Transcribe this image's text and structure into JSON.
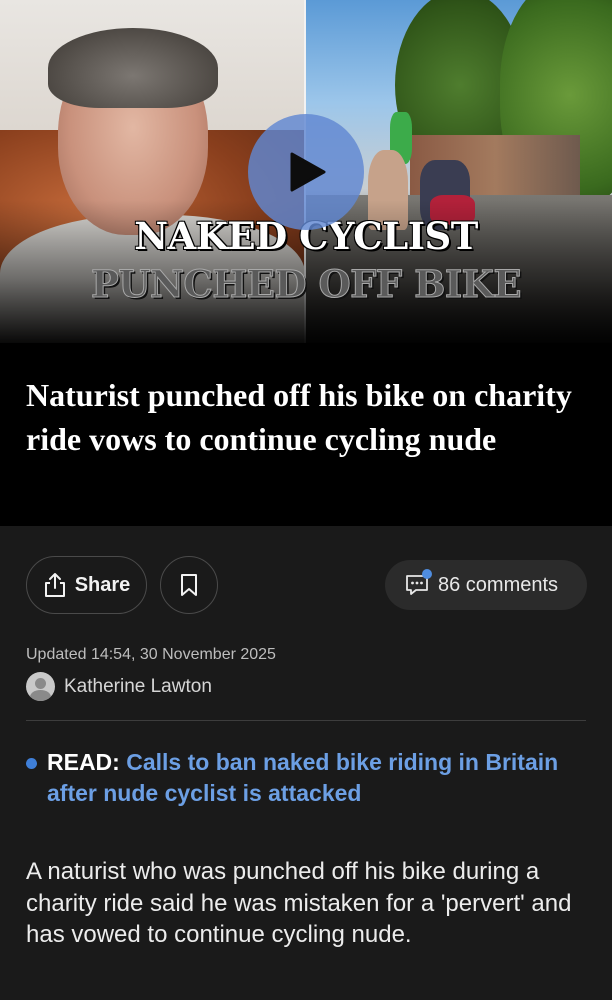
{
  "video": {
    "overlay_line1": "NAKED CYCLIST",
    "overlay_line2": "PUNCHED OFF BIKE"
  },
  "article": {
    "headline": "Naturist punched off his bike on charity ride vows to continue cycling nude",
    "updated": "Updated 14:54, 30 November 2025",
    "author": "Katherine Lawton",
    "read_label": "READ:",
    "read_link": "Calls to ban naked bike riding in Britain after nude cyclist is attacked",
    "body": "A naturist who was punched off his bike during a charity ride said he was mistaken for a 'pervert' and has vowed to continue cycling nude."
  },
  "actions": {
    "share_label": "Share",
    "comments_label": "86 comments"
  },
  "icons": {
    "play": "play-icon",
    "share": "share-icon",
    "bookmark": "bookmark-icon",
    "comment": "comment-icon",
    "avatar": "user-avatar-icon"
  },
  "colors": {
    "background": "#1a1a1a",
    "headline_bg": "#000000",
    "link": "#6c9fe4",
    "play_button": "#6087d2",
    "notification_dot": "#4f8de0"
  }
}
